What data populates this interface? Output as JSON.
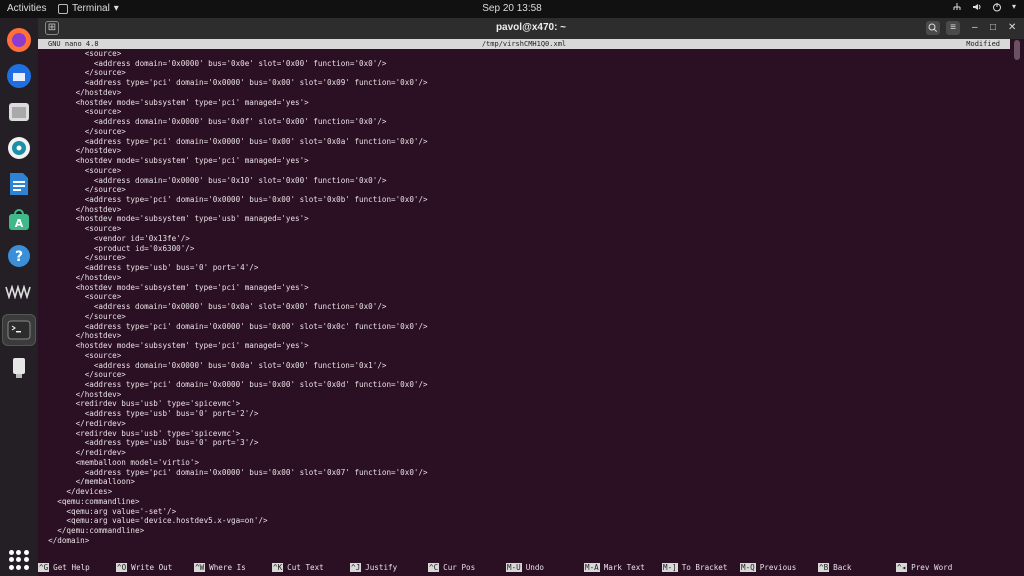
{
  "topbar": {
    "activities": "Activities",
    "app_name": "Terminal",
    "app_menu_arrow": "▾",
    "clock": "Sep 20  13:58",
    "tray": [
      "network-icon",
      "volume-icon",
      "power-icon"
    ]
  },
  "dock": {
    "items": [
      "firefox-icon",
      "thunderbird-icon",
      "files-icon",
      "rhythmbox-icon",
      "writer-icon",
      "software-icon",
      "help-icon",
      "vmm-icon",
      "terminal-icon",
      "usb-drive-icon"
    ],
    "apps_grid": "show-applications-icon"
  },
  "window": {
    "title": "pavol@x470: ~",
    "controls": [
      "search-icon",
      "menu-icon",
      "minimize-icon",
      "maximize-icon",
      "close-icon"
    ]
  },
  "nano": {
    "version": "GNU nano 4.8",
    "filename": "/tmp/virshCMH1Q0.xml",
    "status": "Modified"
  },
  "editor_lines": [
    "          <source>",
    "            <address domain='0x0000' bus='0x0e' slot='0x00' function='0x0'/>",
    "          </source>",
    "          <address type='pci' domain='0x0000' bus='0x00' slot='0x09' function='0x0'/>",
    "        </hostdev>",
    "        <hostdev mode='subsystem' type='pci' managed='yes'>",
    "          <source>",
    "            <address domain='0x0000' bus='0x0f' slot='0x00' function='0x0'/>",
    "          </source>",
    "          <address type='pci' domain='0x0000' bus='0x00' slot='0x0a' function='0x0'/>",
    "        </hostdev>",
    "        <hostdev mode='subsystem' type='pci' managed='yes'>",
    "          <source>",
    "            <address domain='0x0000' bus='0x10' slot='0x00' function='0x0'/>",
    "          </source>",
    "          <address type='pci' domain='0x0000' bus='0x00' slot='0x0b' function='0x0'/>",
    "        </hostdev>",
    "        <hostdev mode='subsystem' type='usb' managed='yes'>",
    "          <source>",
    "            <vendor id='0x13fe'/>",
    "            <product id='0x6300'/>",
    "          </source>",
    "          <address type='usb' bus='0' port='4'/>",
    "        </hostdev>",
    "        <hostdev mode='subsystem' type='pci' managed='yes'>",
    "          <source>",
    "            <address domain='0x0000' bus='0x0a' slot='0x00' function='0x0'/>",
    "          </source>",
    "          <address type='pci' domain='0x0000' bus='0x00' slot='0x0c' function='0x0'/>",
    "        </hostdev>",
    "        <hostdev mode='subsystem' type='pci' managed='yes'>",
    "          <source>",
    "            <address domain='0x0000' bus='0x0a' slot='0x00' function='0x1'/>",
    "          </source>",
    "          <address type='pci' domain='0x0000' bus='0x00' slot='0x0d' function='0x0'/>",
    "        </hostdev>",
    "        <redirdev bus='usb' type='spicevmc'>",
    "          <address type='usb' bus='0' port='2'/>",
    "        </redirdev>",
    "        <redirdev bus='usb' type='spicevmc'>",
    "          <address type='usb' bus='0' port='3'/>",
    "        </redirdev>",
    "        <memballoon model='virtio'>",
    "          <address type='pci' domain='0x0000' bus='0x00' slot='0x07' function='0x0'/>",
    "        </memballoon>",
    "      </devices>",
    "    <qemu:commandline>",
    "      <qemu:arg value='-set'/>",
    "      <qemu:arg value='device.hostdev5.x-vga=on'/>",
    "    </qemu:commandline>",
    "  </domain>"
  ],
  "shortcuts": [
    {
      "key": "^G",
      "label": "Get Help"
    },
    {
      "key": "^O",
      "label": "Write Out"
    },
    {
      "key": "^W",
      "label": "Where Is"
    },
    {
      "key": "^K",
      "label": "Cut Text"
    },
    {
      "key": "^J",
      "label": "Justify"
    },
    {
      "key": "^C",
      "label": "Cur Pos"
    },
    {
      "key": "M-U",
      "label": "Undo"
    },
    {
      "key": "M-A",
      "label": "Mark Text"
    },
    {
      "key": "M-]",
      "label": "To Bracket"
    },
    {
      "key": "M-Q",
      "label": "Previous"
    },
    {
      "key": "^B",
      "label": "Back"
    },
    {
      "key": "^◂",
      "label": "Prev Word"
    }
  ],
  "colors": {
    "terminal_bg": "#2b0f22",
    "text": "#e9e2e7",
    "accent": "#e95420"
  }
}
